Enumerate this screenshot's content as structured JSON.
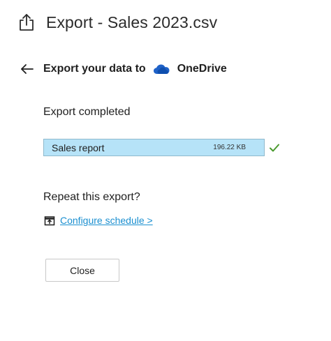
{
  "header": {
    "icon": "export-share-icon",
    "title": "Export - Sales 2023.csv"
  },
  "subheader": {
    "back_icon": "arrow-left-icon",
    "lead": "Export your data to",
    "service_icon": "onedrive-cloud-icon",
    "service": "OneDrive"
  },
  "status": "Export completed",
  "file": {
    "name": "Sales report",
    "size": "196.22 KB",
    "status_icon": "check-icon",
    "bar_color": "#b6e3f8",
    "check_color": "#4a9a2e"
  },
  "repeat": {
    "question": "Repeat this export?",
    "link_icon": "calendar-icon",
    "link_label": "Configure schedule >",
    "link_color": "#1a8fd0"
  },
  "actions": {
    "close_label": "Close"
  }
}
